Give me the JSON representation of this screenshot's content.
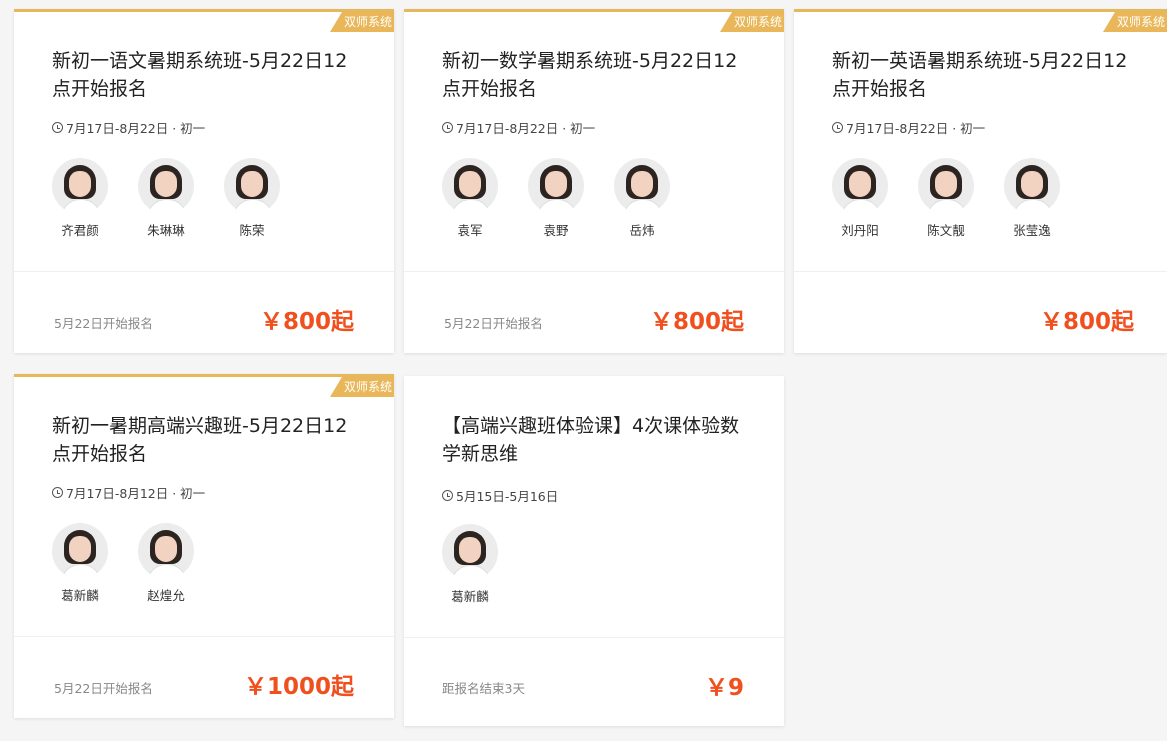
{
  "colors": {
    "accent": "#f0501e",
    "badge": "#e9b75a"
  },
  "cards": [
    {
      "badge": "双师系统",
      "title": "新初一语文暑期系统班-5月22日12点开始报名",
      "meta": "7月17日-8月22日 · 初一",
      "teachers": [
        "齐君颜",
        "朱琳琳",
        "陈荣"
      ],
      "footer_text": "5月22日开始报名",
      "price": "￥800起"
    },
    {
      "badge": "双师系统",
      "title": "新初一数学暑期系统班-5月22日12点开始报名",
      "meta": "7月17日-8月22日 · 初一",
      "teachers": [
        "袁军",
        "袁野",
        "岳炜"
      ],
      "footer_text": "5月22日开始报名",
      "price": "￥800起"
    },
    {
      "badge": "双师系统",
      "title": "新初一英语暑期系统班-5月22日12点开始报名",
      "meta": "7月17日-8月22日 · 初一",
      "teachers": [
        "刘丹阳",
        "陈文靓",
        "张莹逸"
      ],
      "footer_text": "",
      "price": "￥800起"
    },
    {
      "badge": "双师系统",
      "title": "新初一暑期高端兴趣班-5月22日12点开始报名",
      "meta": "7月17日-8月12日 · 初一",
      "teachers": [
        "葛新麟",
        "赵煌允"
      ],
      "footer_text": "5月22日开始报名",
      "price": "￥1000起"
    },
    {
      "badge": "",
      "title": "【高端兴趣班体验课】4次课体验数学新思维",
      "meta": "5月15日-5月16日",
      "teachers": [
        "葛新麟"
      ],
      "footer_text": "距报名结束3天",
      "price": "￥9"
    }
  ]
}
